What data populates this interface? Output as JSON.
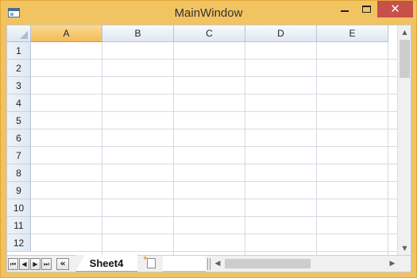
{
  "window": {
    "title": "MainWindow",
    "close_glyph": "✕",
    "accent_color": "#f2c461",
    "close_color": "#c7504b"
  },
  "spreadsheet": {
    "columns": [
      "A",
      "B",
      "C",
      "D",
      "E"
    ],
    "active_column": "A",
    "rows": [
      "1",
      "2",
      "3",
      "4",
      "5",
      "6",
      "7",
      "8",
      "9",
      "10",
      "11",
      "12"
    ]
  },
  "sheet_tabs": {
    "nav": {
      "first": "⏮",
      "prev": "◀",
      "next": "▶",
      "last": "⏭",
      "collapse": "«"
    },
    "active_tab": "Sheet4",
    "add_sheet_icon": "new-sheet-icon"
  },
  "scrollbars": {
    "up_arrow": "▲",
    "down_arrow": "▼",
    "left_arrow": "◀",
    "right_arrow": "▶"
  }
}
